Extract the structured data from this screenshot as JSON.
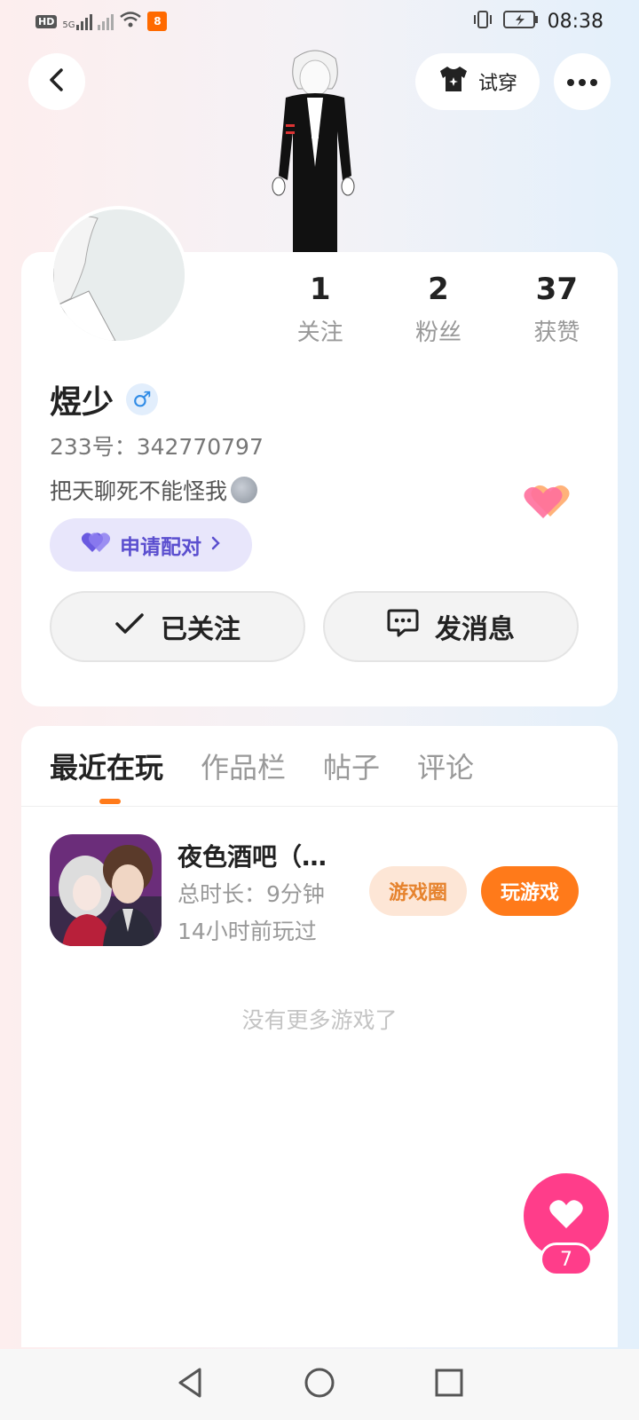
{
  "status_bar": {
    "hd_label": "HD",
    "network_label": "5G",
    "app_badge": "8",
    "time": "08:38"
  },
  "header": {
    "back_icon": "chevron-left-icon",
    "try_on_label": "试穿",
    "more_icon": "more-dots-icon"
  },
  "profile": {
    "stats": [
      {
        "value": "1",
        "label": "关注"
      },
      {
        "value": "2",
        "label": "粉丝"
      },
      {
        "value": "37",
        "label": "获赞"
      }
    ],
    "username": "煜少",
    "gender_symbol": "♂",
    "uid": "233号：342770797",
    "bio": "把天聊死不能怪我",
    "pair_button": "申请配对",
    "follow_button": "已关注",
    "message_button": "发消息",
    "accent_color": "#5b4fcf"
  },
  "tabs": [
    {
      "label": "最近在玩",
      "active": true
    },
    {
      "label": "作品栏",
      "active": false
    },
    {
      "label": "帖子",
      "active": false
    },
    {
      "label": "评论",
      "active": false
    }
  ],
  "recent_game": {
    "title": "夜色酒吧（…",
    "duration": "总时长：9分钟",
    "last_played": "14小时前玩过",
    "circle_button": "游戏圈",
    "play_button": "玩游戏"
  },
  "empty_hint": "没有更多游戏了",
  "like_fab": {
    "count": "7"
  },
  "colors": {
    "orange": "#ff7a1a",
    "pink": "#ff3d8a",
    "purple": "#5b4fcf"
  }
}
